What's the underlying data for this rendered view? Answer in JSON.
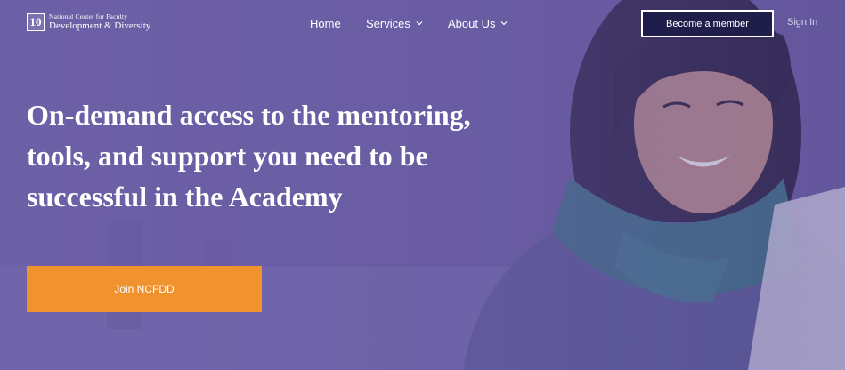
{
  "brand": {
    "mark": "10",
    "line1": "National Center for Faculty",
    "line2": "Development & Diversity"
  },
  "nav": {
    "home": "Home",
    "services": "Services",
    "about": "About Us"
  },
  "header": {
    "member_button": "Become a member",
    "sign_in": "Sign In"
  },
  "hero": {
    "headline": "On-demand access to the mentoring, tools, and support you need to be successful in the Academy",
    "cta": "Join NCFDD"
  },
  "colors": {
    "overlay": "#6b5ea3",
    "cta": "#f0922e",
    "member_button_bg": "#1f1d4a"
  }
}
